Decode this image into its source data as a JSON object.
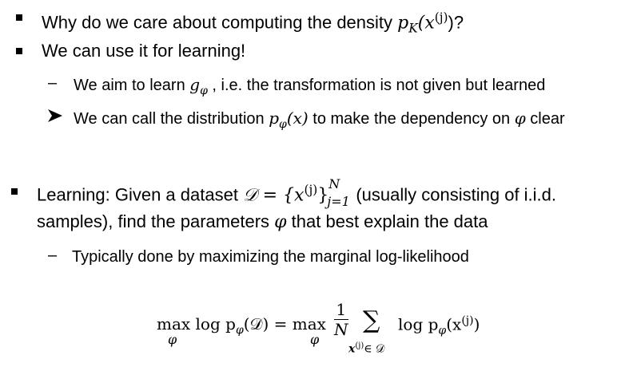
{
  "bullets": {
    "b1_text": "Why do we care about computing the density ",
    "b1_math": "p",
    "b1_sub": "K",
    "b1_arg": "(x",
    "b1_sup": "(j)",
    "b1_end": ")?",
    "b2_text": "We can use it for learning!",
    "s1_pre": "We aim to learn ",
    "s1_g": "g",
    "s1_phi": "φ",
    "s1_post": " , i.e. the transformation is not given but learned",
    "s2_pre": "We can call the distribution ",
    "s2_p": "p",
    "s2_phi": "φ",
    "s2_arg": "(x)",
    "s2_post": " to make the dependency on ",
    "s2_phi2": "φ",
    "s2_end": " clear",
    "b3_pre": "Learning: Given a dataset ",
    "b3_D": "𝒟 = {x",
    "b3_sup": "(j)",
    "b3_brace": "}",
    "b3_N": "N",
    "b3_j1": "j=1",
    "b3_post": " (usually consisting of i.i.d.",
    "b3_line2_pre": "samples), find the parameters ",
    "b3_phi": "φ",
    "b3_line2_post": " that best explain the data",
    "s3_text": "Typically done by maximizing the marginal log-likelihood"
  },
  "equation": {
    "lhs": "max log p",
    "lhs_sub_phi": "φ",
    "lhs_arg": "(𝒟) = max",
    "under_max1": "φ",
    "under_max2": "φ",
    "frac_num": "1",
    "frac_den": "N",
    "sum": "∑",
    "sum_under": "x",
    "sum_under_sup": "(j)",
    "sum_under_end": "∈ 𝒟",
    "rhs": "log p",
    "rhs_sub": "φ",
    "rhs_arg": "(x",
    "rhs_sup": "(j)",
    "rhs_end": ")"
  }
}
